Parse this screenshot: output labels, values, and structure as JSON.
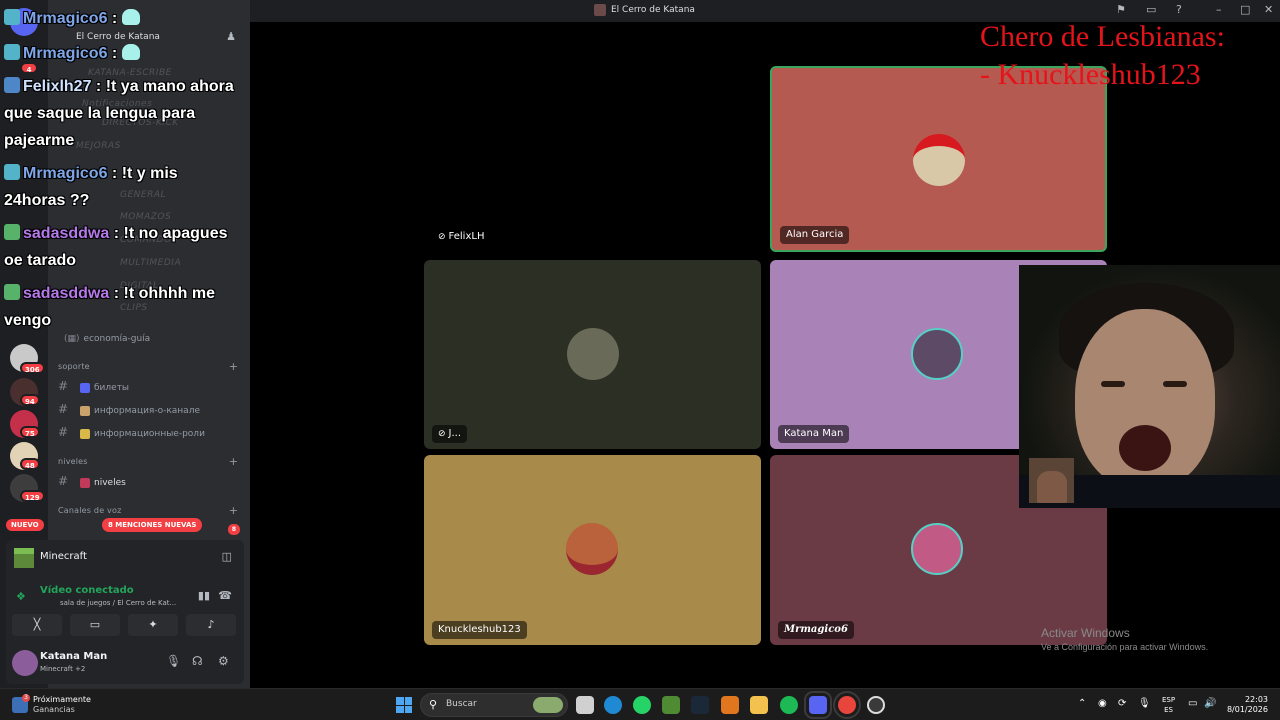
{
  "window": {
    "title": "El Cerro de Katana"
  },
  "server": {
    "name": "El Cerro de Katana"
  },
  "server_badges": [
    "4",
    "306",
    "94",
    "75",
    "48",
    "129"
  ],
  "channels_faded": [
    "KATANA-ESCRIBE",
    "Notificaciones",
    "DIRECTOS-KICK",
    "MEJORAS",
    "GENERAL",
    "MOMAZOS",
    "COMANDOS",
    "MULTIMEDIA",
    "DIGITAL",
    "CLIPS"
  ],
  "channels": {
    "economia": "economía-guía",
    "soporte_category": "soporte",
    "soporte_items": [
      "билеты",
      "информация-о-канале",
      "информационные-роли"
    ],
    "niveles_category": "niveles",
    "niveles_items": [
      "niveles"
    ],
    "voice_category": "Canales de voz"
  },
  "mentions": {
    "nuevo": "NUEVO",
    "banner": "8 MENCIONES NUEVAS",
    "count": "8"
  },
  "chat": [
    {
      "user": "Mrmagico6",
      "sep": " : ",
      "text": ""
    },
    {
      "user": "Mrmagico6",
      "sep": " : ",
      "text": ""
    },
    {
      "user": "Felixlh27",
      "sep": " : ",
      "text": "!t ya mano ahora"
    },
    {
      "cont": "que saque la lengua para"
    },
    {
      "cont": "pajearme"
    },
    {
      "user": "Mrmagico6",
      "sep": " : ",
      "text": "!t y mis"
    },
    {
      "cont": "24horas ??"
    },
    {
      "user": "sadasddwa",
      "sep": " : ",
      "text": "!t no apagues"
    },
    {
      "cont": "oe tarado"
    },
    {
      "user": "sadasddwa",
      "sep": " : ",
      "text": "!t ohhhh me"
    },
    {
      "cont": "vengo"
    }
  ],
  "activity": {
    "game": "Minecraft"
  },
  "voice": {
    "status": "Vídeo conectado",
    "channel": "sala de juegos / El Cerro de Kat..."
  },
  "account": {
    "name": "Katana Man",
    "status": "Minecraft +2"
  },
  "tiles": {
    "felix": "FelixLH",
    "alan": "Alan Garcia",
    "j": "J...",
    "katana": "Katana Man",
    "knuckles": "Knuckleshub123",
    "mrmagico": "Mrmagico6"
  },
  "overlay": {
    "line1": "Chero de Lesbianas:",
    "line2": "- Knuckleshub123"
  },
  "activate_windows": {
    "title": "Activar Windows",
    "subtitle": "Ve a Configuración para activar Windows."
  },
  "taskbar": {
    "widget_badge": "3",
    "widget_line1": "Próximamente",
    "widget_line2": "Ganancias",
    "search": "Buscar",
    "lang1": "ESP",
    "lang2": "ES",
    "time": "22:03",
    "date": "8/01/2026"
  },
  "colors": {
    "discord_bg": "#2b2d31",
    "alan_tile": "#b55a51",
    "j_tile": "#2c2f24",
    "katana_tile": "#a983b8",
    "knuckles_tile": "#a88a4a",
    "mrmagico_tile": "#6b3b45",
    "overlay_red": "#e4141a",
    "voice_green": "#23a55a"
  }
}
